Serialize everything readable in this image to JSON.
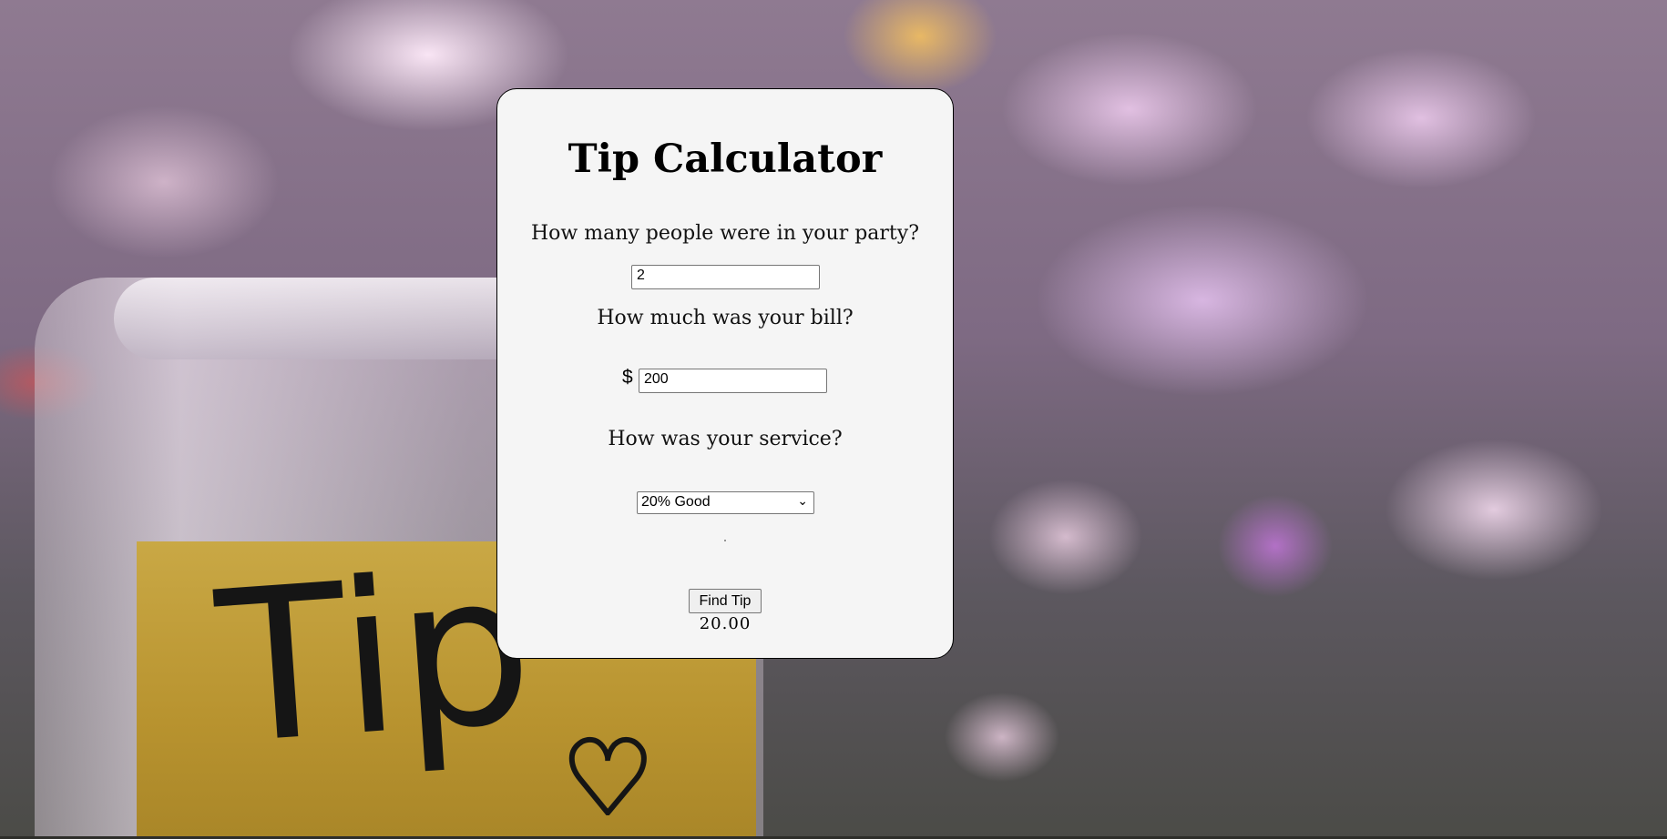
{
  "background": {
    "jar_label_text": "Tip"
  },
  "calculator": {
    "title": "Tip Calculator",
    "party_question": "How many people were in your party?",
    "party_value": "2",
    "bill_question": "How much was your bill?",
    "currency_symbol": "$",
    "bill_value": "200",
    "service_question": "How was your service?",
    "service_selected": "20% Good",
    "find_button_label": "Find Tip",
    "tip_result": "20.00"
  },
  "colors": {
    "card_background": "#f5f5f5",
    "card_border": "#000000",
    "button_background": "#efefef"
  }
}
